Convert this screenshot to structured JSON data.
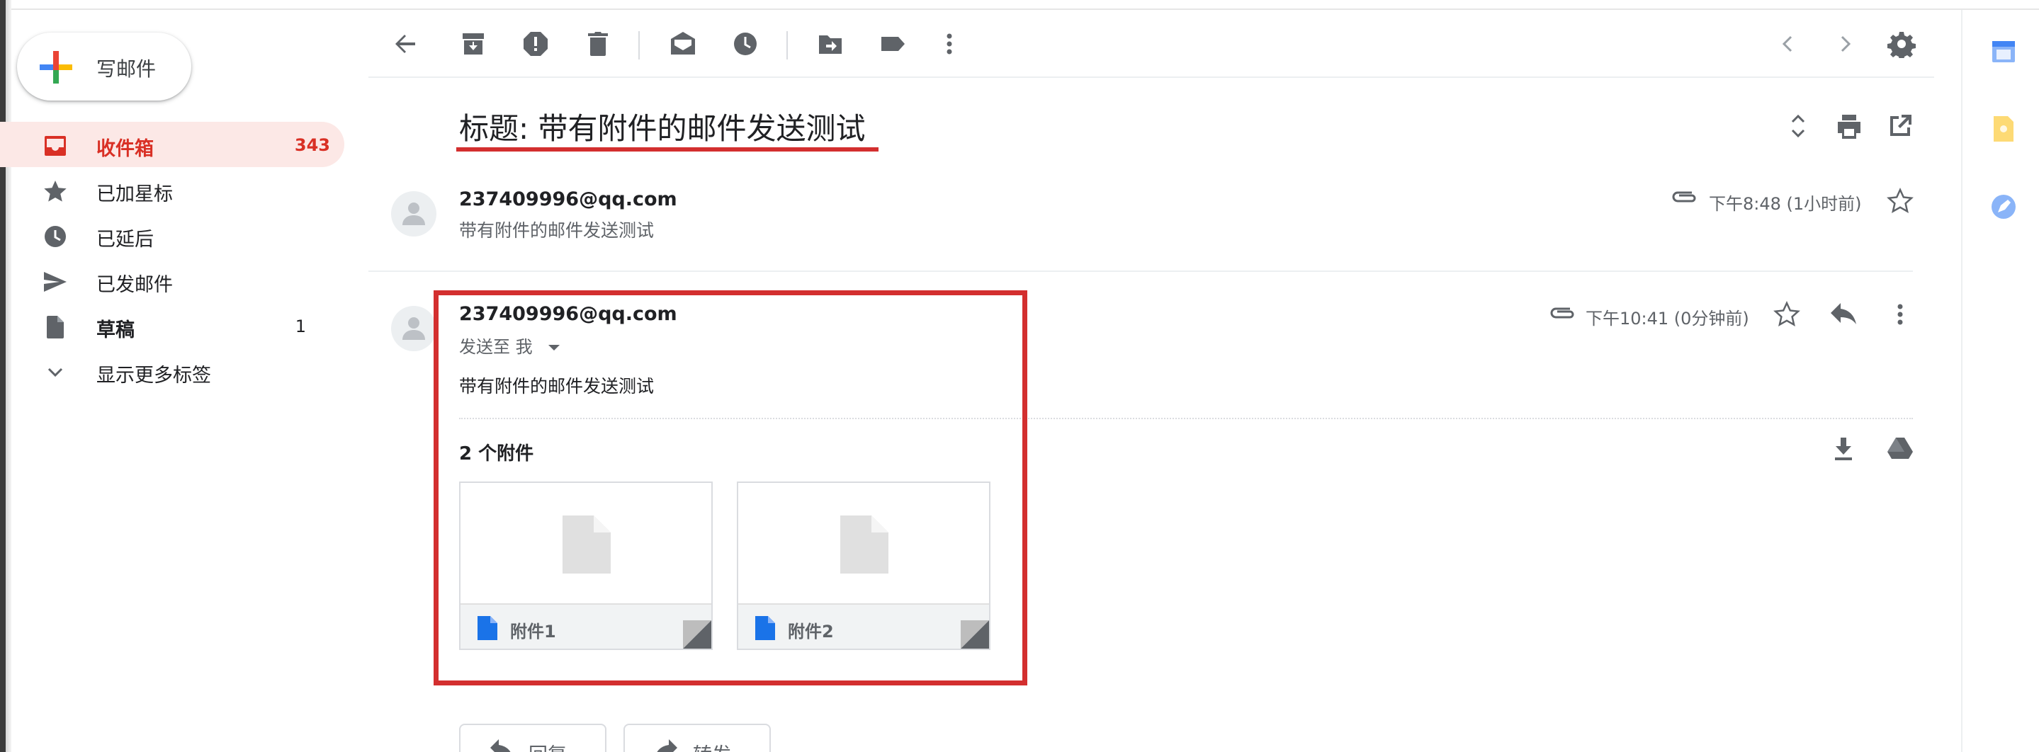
{
  "compose": {
    "label": "写邮件"
  },
  "nav": {
    "items": [
      {
        "label": "收件箱",
        "count": "343"
      },
      {
        "label": "已加星标",
        "count": ""
      },
      {
        "label": "已延后",
        "count": ""
      },
      {
        "label": "已发邮件",
        "count": ""
      },
      {
        "label": "草稿",
        "count": "1"
      },
      {
        "label": "显示更多标签",
        "count": ""
      }
    ]
  },
  "subject": "标题: 带有附件的邮件发送测试",
  "thread": {
    "messages": [
      {
        "sender": "237409996@qq.com",
        "snippet": "带有附件的邮件发送测试",
        "time": "下午8:48 (1小时前)"
      },
      {
        "sender": "237409996@qq.com",
        "to": "发送至 我",
        "time": "下午10:41 (0分钟前)",
        "body": "带有附件的邮件发送测试",
        "attachments_count": "2 个附件",
        "attachments": [
          {
            "name": "附件1"
          },
          {
            "name": "附件2"
          }
        ]
      }
    ]
  },
  "actions": {
    "reply": "回复",
    "forward": "转发"
  },
  "colors": {
    "accent_red": "#d93025",
    "highlight": "#d32f2f",
    "active_bg": "#fce8e6",
    "icon_gray": "#5f6368",
    "doc_blue": "#1a73e8"
  },
  "icons": {
    "toolbar": [
      "back-arrow-icon",
      "archive-icon",
      "report-spam-icon",
      "delete-icon",
      "mark-unread-icon",
      "snooze-icon",
      "move-to-icon",
      "label-icon",
      "more-vert-icon",
      "chevron-left-icon",
      "chevron-right-icon",
      "settings-gear-icon"
    ],
    "side_panel": [
      "calendar-icon",
      "keep-icon",
      "tasks-icon"
    ]
  }
}
